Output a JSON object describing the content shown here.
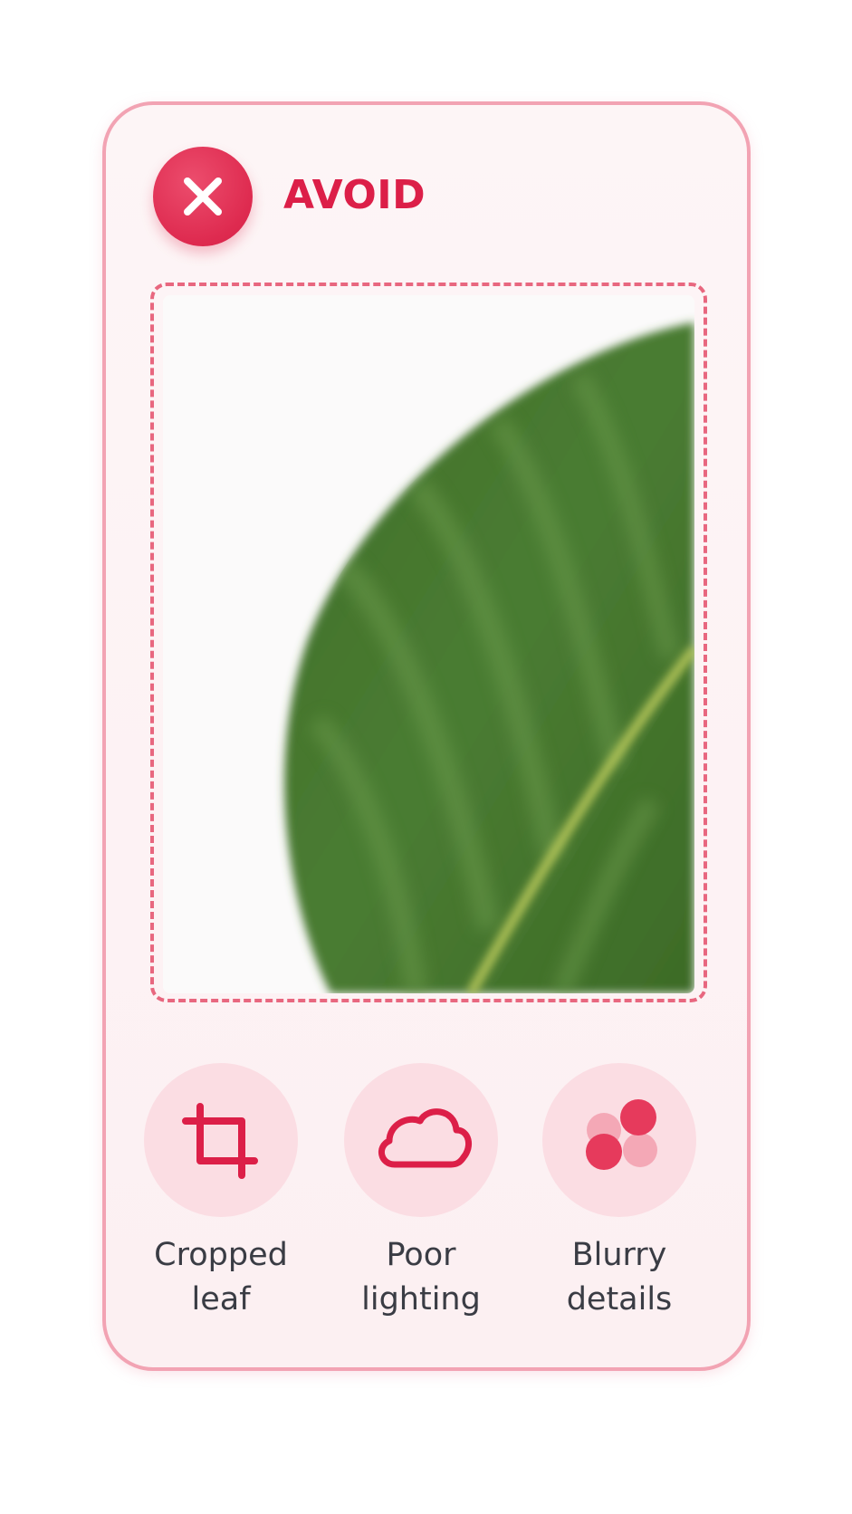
{
  "card": {
    "title": "AVOID",
    "accent_color": "#dc1f48",
    "border_color": "#f2a3b3",
    "header_icon": "close-icon"
  },
  "example_photo": {
    "subject": "cropped-blurry-leaf",
    "frame_style": "dashed"
  },
  "issues": [
    {
      "icon": "crop-icon",
      "label": "Cropped\nleaf"
    },
    {
      "icon": "cloud-icon",
      "label": "Poor\nlighting"
    },
    {
      "icon": "blur-dots-icon",
      "label": "Blurry\ndetails"
    }
  ]
}
